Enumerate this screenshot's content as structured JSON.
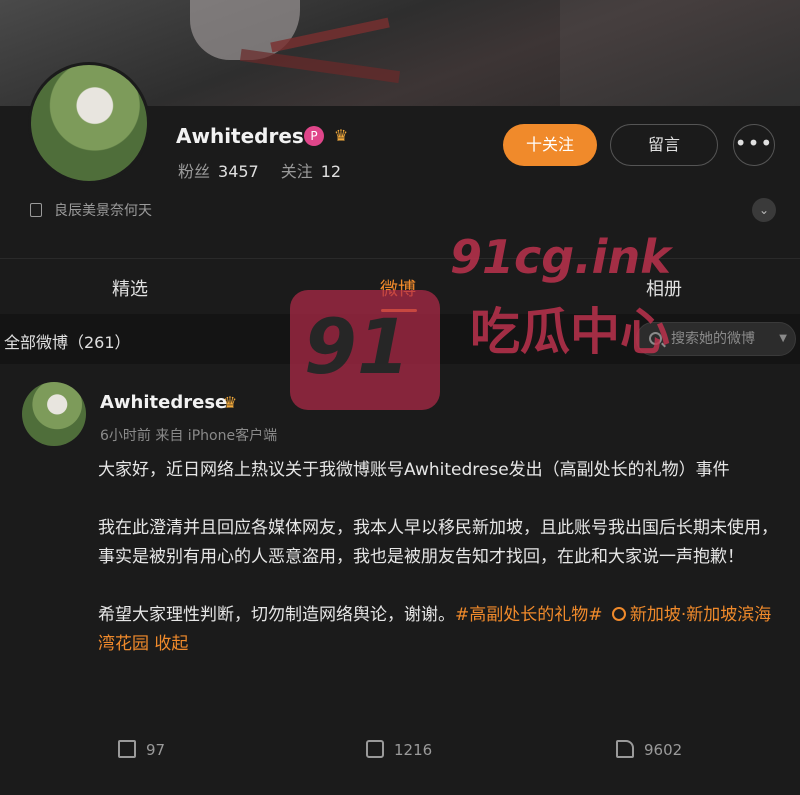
{
  "profile": {
    "name": "Awhitedrese",
    "badge_letter": "P",
    "fans_label": "粉丝",
    "fans": "3457",
    "following_label": "关注",
    "following": "12",
    "follow_button": "十关注",
    "message_button": "留言",
    "more_button": "•••",
    "bio": "良辰美景奈何天"
  },
  "tabs": [
    {
      "label": "精选"
    },
    {
      "label": "微博"
    },
    {
      "label": "相册"
    }
  ],
  "filter": {
    "label": "全部微博（261）",
    "search_placeholder": "搜索她的微博"
  },
  "post": {
    "name": "Awhitedrese",
    "meta": "6小时前  来自 iPhone客户端",
    "para1": "大家好，近日网络上热议关于我微博账号Awhitedrese发出（高副处长的礼物）事件",
    "para2": "我在此澄清并且回应各媒体网友，我本人早以移民新加坡，且此账号我出国后长期未使用，事实是被别有用心的人恶意盗用，我也是被朋友告知才找回，在此和大家说一声抱歉！",
    "para3_text": "希望大家理性判断，切勿制造网络舆论，谢谢。",
    "hashtag": "#高副处长的礼物#",
    "location": "新加坡·新加坡滨海湾花园",
    "collapse": "收起",
    "shares": "97",
    "comments": "1216",
    "likes": "9602"
  },
  "watermark": {
    "number": "91",
    "site": "91cg.ink",
    "name": "吃瓜中心"
  },
  "colors": {
    "accent": "#f08a2b",
    "background": "#1a1a1a",
    "watermark": "#c2334f"
  }
}
